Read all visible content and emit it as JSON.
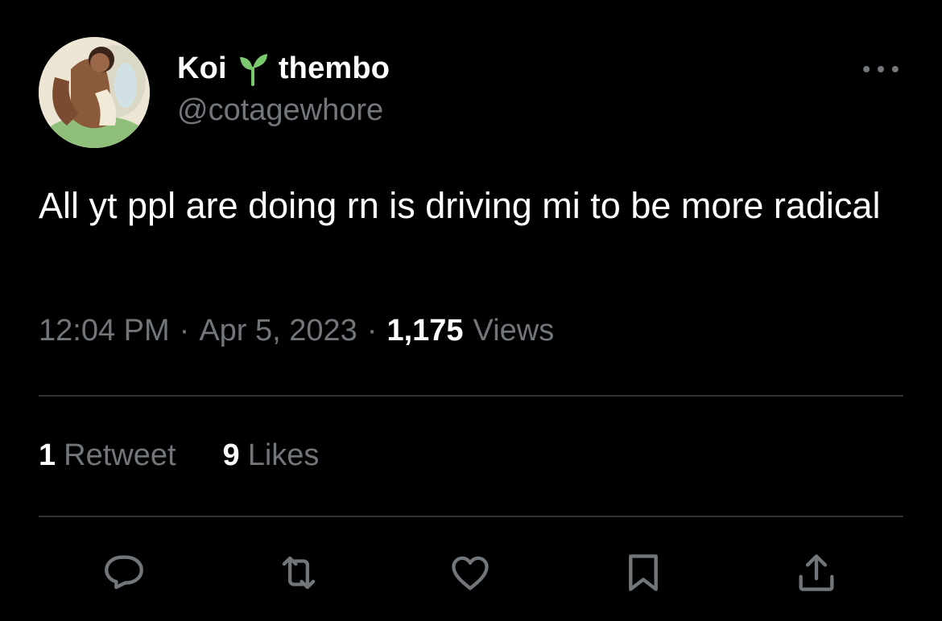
{
  "author": {
    "display_name": "Koi",
    "name_suffix": "thembo",
    "handle": "@cotagewhore",
    "emoji_icon": "seedling-icon"
  },
  "tweet": {
    "text": "All yt ppl are doing rn is driving mi to be more radical",
    "time": "12:04 PM",
    "separator": "·",
    "date": "Apr 5, 2023",
    "views_count": "1,175",
    "views_label": "Views"
  },
  "stats": {
    "retweets_count": "1",
    "retweets_label": "Retweet",
    "likes_count": "9",
    "likes_label": "Likes"
  },
  "actions": [
    "reply-icon",
    "retweet-icon",
    "like-icon",
    "bookmark-icon",
    "share-icon"
  ],
  "colors": {
    "background": "#000000",
    "primary_text": "#ffffff",
    "secondary_text": "#71767b",
    "divider": "#2f3336",
    "sprout": "#7bc96f"
  }
}
